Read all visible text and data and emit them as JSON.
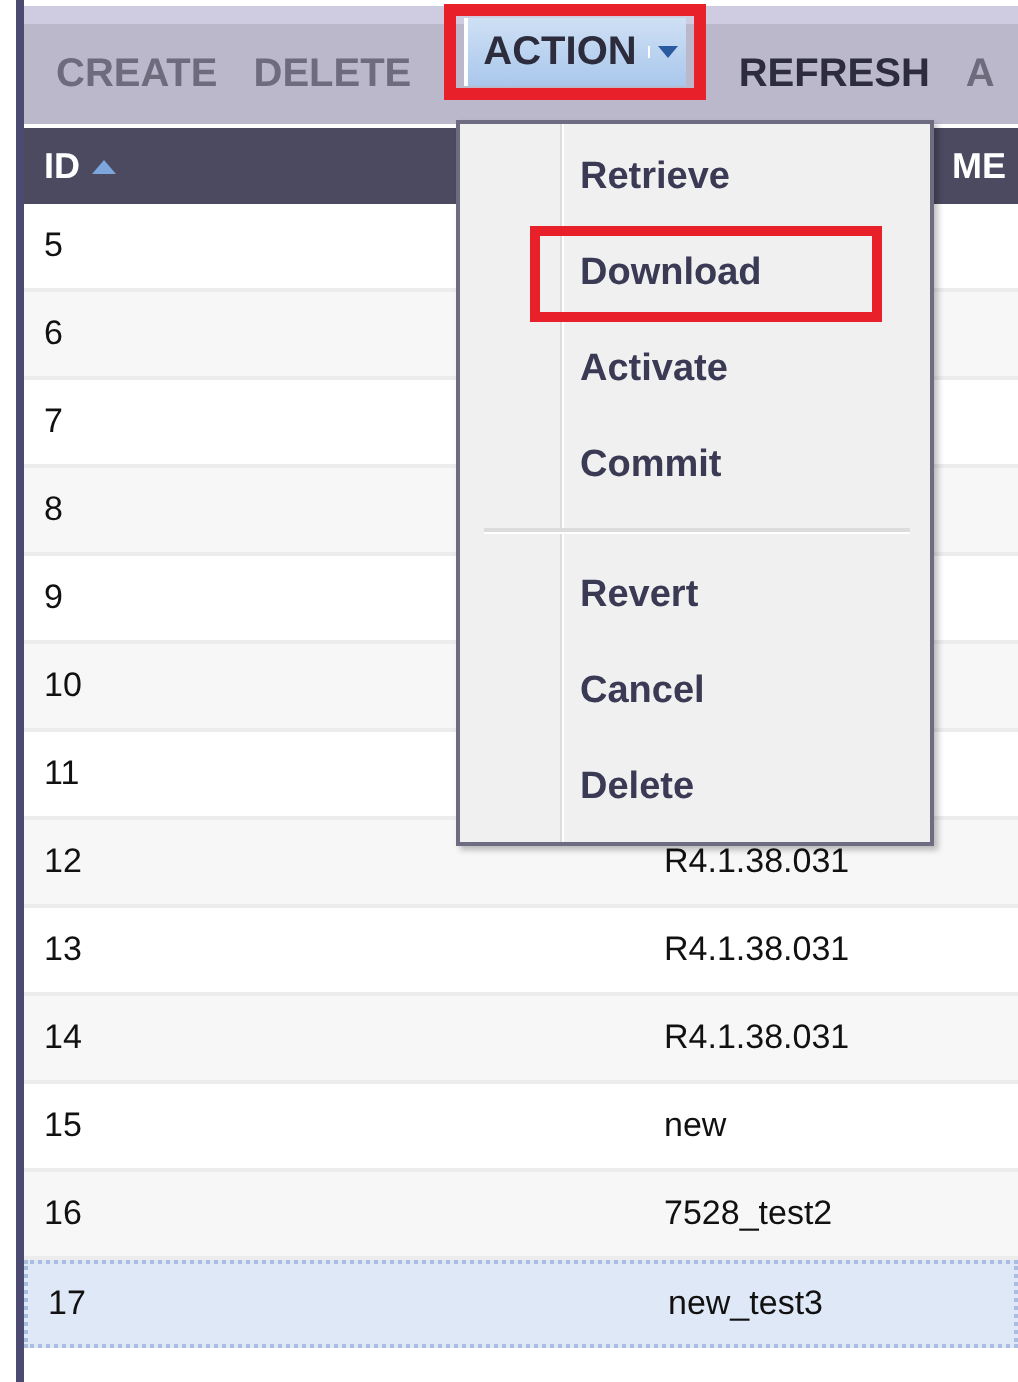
{
  "toolbar": {
    "buttons": [
      {
        "label": "CREATE",
        "disabled": true,
        "annotated": false,
        "kind": "button"
      },
      {
        "label": "DELETE",
        "disabled": true,
        "annotated": false,
        "kind": "button"
      },
      {
        "label": "ACTION",
        "disabled": false,
        "annotated": true,
        "kind": "dropdown"
      },
      {
        "label": "REFRESH",
        "disabled": false,
        "annotated": false,
        "kind": "button"
      },
      {
        "label": "A",
        "disabled": true,
        "annotated": false,
        "kind": "button"
      }
    ]
  },
  "table": {
    "columns": [
      {
        "label": "ID",
        "sorted_ascending": true
      },
      {
        "label": "ME"
      }
    ],
    "rows": [
      {
        "id": "5",
        "selected": false
      },
      {
        "id": "6",
        "selected": false
      },
      {
        "id": "7",
        "selected": false
      },
      {
        "id": "8",
        "selected": false
      },
      {
        "id": "9",
        "selected": false
      },
      {
        "id": "10",
        "selected": false
      },
      {
        "id": "11",
        "selected": false
      },
      {
        "id": "12",
        "column_2": "R4.1.38.031",
        "selected": false
      },
      {
        "id": "13",
        "column_2": "R4.1.38.031",
        "selected": false
      },
      {
        "id": "14",
        "column_2": "R4.1.38.031",
        "selected": false
      },
      {
        "id": "15",
        "column_2": "new",
        "selected": false
      },
      {
        "id": "16",
        "column_2": "7528_test2",
        "selected": false
      },
      {
        "id": "17",
        "column_2": "new_test3",
        "selected": true
      }
    ]
  },
  "action_menu": {
    "items": [
      {
        "kind": "item",
        "label": "Retrieve",
        "annotated": false
      },
      {
        "kind": "item",
        "label": "Download",
        "annotated": true
      },
      {
        "kind": "item",
        "label": "Activate",
        "annotated": false
      },
      {
        "kind": "item",
        "label": "Commit",
        "annotated": false
      },
      {
        "kind": "separator"
      },
      {
        "kind": "item",
        "label": "Revert",
        "annotated": false
      },
      {
        "kind": "item",
        "label": "Cancel",
        "annotated": false
      },
      {
        "kind": "item",
        "label": "Delete",
        "annotated": false
      }
    ]
  }
}
